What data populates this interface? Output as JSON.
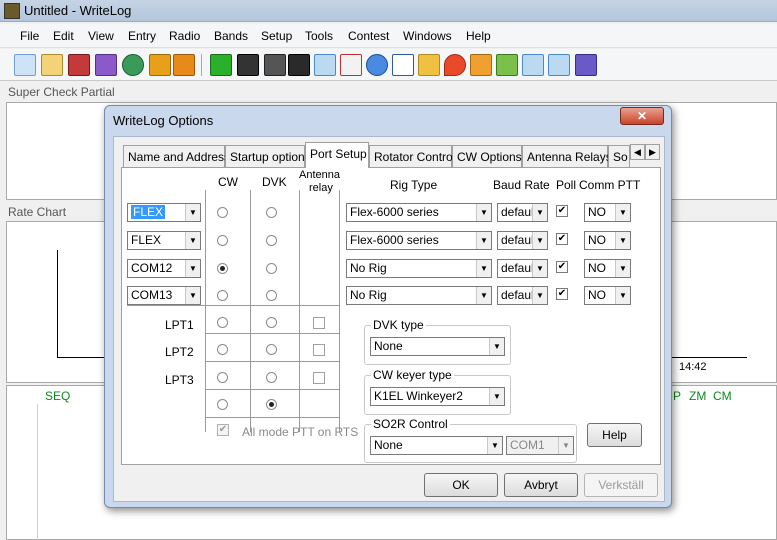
{
  "app": {
    "title": "Untitled - WriteLog"
  },
  "menu": [
    "File",
    "Edit",
    "View",
    "Entry",
    "Radio",
    "Bands",
    "Setup",
    "Tools",
    "Contest",
    "Windows",
    "Help"
  ],
  "panes": {
    "super_check_partial": "Super Check Partial",
    "rate_chart": "Rate Chart",
    "rate_time": "14:42",
    "band_labels": {
      "seq": "SEQ",
      "p": "P",
      "zm": "ZM",
      "cm": "CM"
    }
  },
  "dialog": {
    "title": "WriteLog Options",
    "close_glyph": "✕",
    "tabs": [
      "Name and Address",
      "Startup options",
      "Port Setup",
      "Rotator Control",
      "CW Options",
      "Antenna Relays",
      "So"
    ],
    "active_tab": "Port Setup",
    "scroll_left": "◀",
    "scroll_right": "▶",
    "columns": {
      "cw": "CW",
      "dvk": "DVK",
      "antenna": "Antenna",
      "relay": "relay",
      "rig_type": "Rig Type",
      "baud_rate": "Baud Rate",
      "poll": "Poll",
      "comm_ptt": "Comm PTT"
    },
    "rows": [
      {
        "port": "FLEX",
        "rig": "Flex-6000 series",
        "baud": "default",
        "poll": true,
        "ptt": "NO",
        "cw": false,
        "dvk": false
      },
      {
        "port": "FLEX",
        "rig": "Flex-6000 series",
        "baud": "default",
        "poll": true,
        "ptt": "NO",
        "cw": false,
        "dvk": false
      },
      {
        "port": "COM12",
        "rig": "No Rig",
        "baud": "default",
        "poll": true,
        "ptt": "NO",
        "cw": true,
        "dvk": false
      },
      {
        "port": "COM13",
        "rig": "No Rig",
        "baud": "default",
        "poll": true,
        "ptt": "NO",
        "cw": false,
        "dvk": false
      }
    ],
    "lpt_rows": [
      {
        "label": "LPT1",
        "cw": false,
        "dvk": false,
        "relay": false
      },
      {
        "label": "LPT2",
        "cw": false,
        "dvk": false,
        "relay": false
      },
      {
        "label": "LPT3",
        "cw": false,
        "dvk": false,
        "relay": false
      }
    ],
    "extra_row": {
      "cw": false,
      "dvk": true
    },
    "all_mode_ptt": "All mode PTT on  RTS",
    "all_mode_checked": true,
    "dvk_type": {
      "label": "DVK type",
      "value": "None"
    },
    "cw_keyer": {
      "label": "CW keyer type",
      "value": "K1EL Winkeyer2"
    },
    "so2r": {
      "label": "SO2R Control",
      "value": "None",
      "port": "COM1"
    },
    "buttons": {
      "help": "Help",
      "ok": "OK",
      "cancel": "Avbryt",
      "apply": "Verkställ"
    },
    "check_glyph": "✔",
    "arrow_glyph": "▼"
  }
}
